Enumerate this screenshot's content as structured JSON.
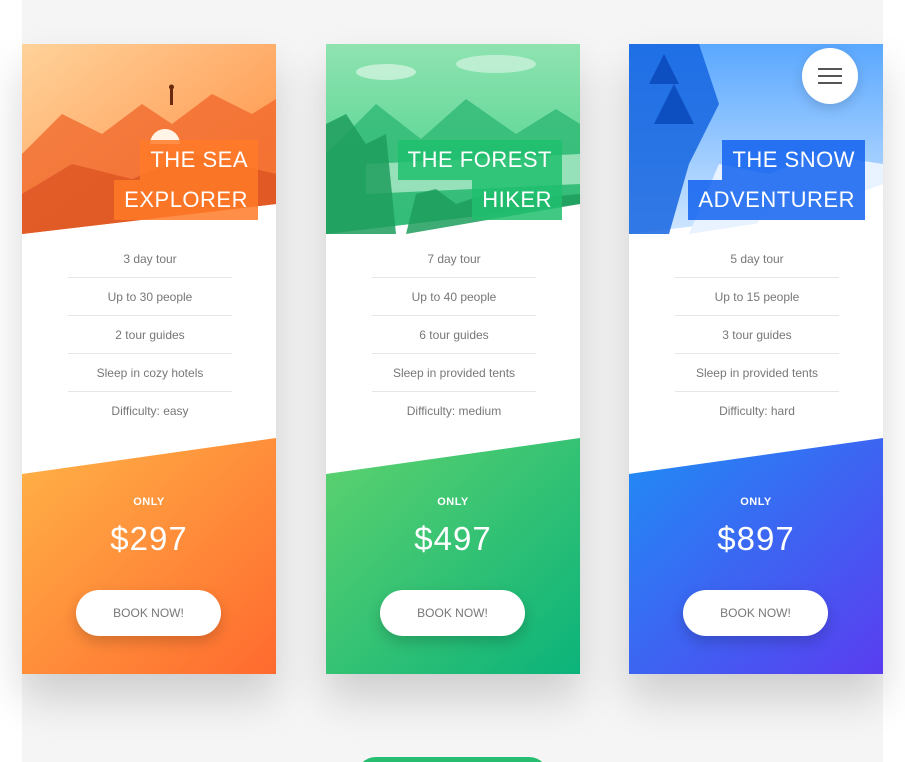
{
  "menu": {
    "icon": "hamburger-menu-icon"
  },
  "cards": [
    {
      "title_line1": "THE SEA",
      "title_line2": "EXPLORER",
      "picture": "sea-explorer-landscape-image",
      "features": [
        "3 day tour",
        "Up to 30 people",
        "2 tour guides",
        "Sleep in cozy hotels",
        "Difficulty: easy"
      ],
      "only_label": "ONLY",
      "price": "$297",
      "cta": "BOOK NOW!",
      "colors": {
        "start": "#ffb347",
        "end": "#ff6a2e"
      }
    },
    {
      "title_line1": "THE FOREST",
      "title_line2": "HIKER",
      "picture": "forest-hiker-landscape-image",
      "features": [
        "7 day tour",
        "Up to 40 people",
        "6 tour guides",
        "Sleep in provided tents",
        "Difficulty: medium"
      ],
      "only_label": "ONLY",
      "price": "$497",
      "cta": "BOOK NOW!",
      "colors": {
        "start": "#5fd26e",
        "end": "#0bb37a"
      }
    },
    {
      "title_line1": "THE SNOW",
      "title_line2": "ADVENTURER",
      "picture": "snow-adventurer-landscape-image",
      "features": [
        "5 day tour",
        "Up to 15 people",
        "3 tour guides",
        "Sleep in provided tents",
        "Difficulty: hard"
      ],
      "only_label": "ONLY",
      "price": "$897",
      "cta": "BOOK NOW!",
      "colors": {
        "start": "#1f8df5",
        "end": "#5a3df0"
      }
    }
  ]
}
